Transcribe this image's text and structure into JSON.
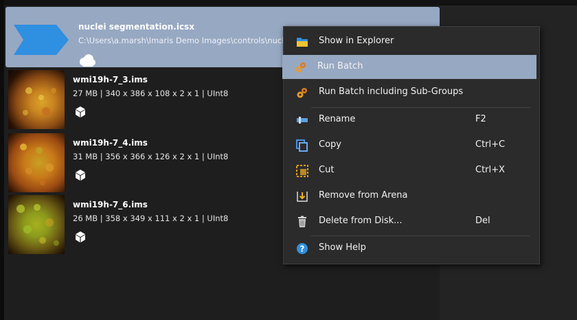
{
  "batch": {
    "name": "nuclei segmentation.icsx",
    "path": "C:\\Users\\a.marsh\\Imaris Demo Images\\controls\\nuclei segmentation.icsx",
    "icon": "batch-arrow-icon",
    "type_icon": "cloud-icon"
  },
  "datasets": [
    {
      "name": "wmi19h-7_3.ims",
      "info": "27 MB | 340 x 386 x 108 x 2 x 1 | UInt8",
      "icon": "cube-icon"
    },
    {
      "name": "wmi19h-7_4.ims",
      "info": "31 MB | 356 x 366 x 126 x 2 x 1 | UInt8",
      "icon": "cube-icon"
    },
    {
      "name": "wmi19h-7_6.ims",
      "info": "26 MB | 358 x 349 x 111 x 2 x 1 | UInt8",
      "icon": "cube-icon"
    }
  ],
  "context_menu": {
    "items": [
      {
        "label": "Show in Explorer",
        "shortcut": "",
        "icon": "folder-icon"
      },
      {
        "label": "Run Batch",
        "shortcut": "",
        "icon": "gears-icon",
        "highlighted": true
      },
      {
        "label": "Run Batch including Sub-Groups",
        "shortcut": "",
        "icon": "gears-icon"
      },
      {
        "label": "Rename",
        "shortcut": "F2",
        "icon": "rename-icon"
      },
      {
        "label": "Copy",
        "shortcut": "Ctrl+C",
        "icon": "copy-icon"
      },
      {
        "label": "Cut",
        "shortcut": "Ctrl+X",
        "icon": "cut-icon"
      },
      {
        "label": "Remove from Arena",
        "shortcut": "",
        "icon": "remove-icon"
      },
      {
        "label": "Delete from Disk...",
        "shortcut": "Del",
        "icon": "trash-icon"
      },
      {
        "label": "Show Help",
        "shortcut": "",
        "icon": "help-icon"
      }
    ]
  },
  "colors": {
    "selection": "#97a8c2",
    "batch_icon": "#2f8fe0",
    "menu_bg": "#2b2b2b",
    "gear_orange": "#e07a1e"
  }
}
